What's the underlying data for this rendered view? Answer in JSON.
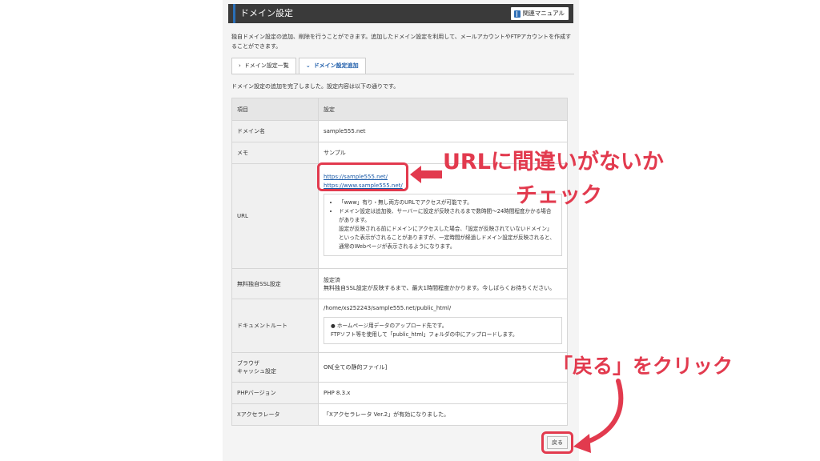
{
  "header": {
    "title": "ドメイン設定",
    "manual_label": "関連マニュアル"
  },
  "description": "独自ドメイン設定の追加、削除を行うことができます。追加したドメイン設定を利用して、メールアカウントやFTPアカウントを作成することができます。",
  "tabs": [
    {
      "label": "ドメイン設定一覧",
      "active": false
    },
    {
      "label": "ドメイン設定追加",
      "active": true
    }
  ],
  "completion_message": "ドメイン設定の追加を完了しました。設定内容は以下の通りです。",
  "table": {
    "col_item": "項目",
    "col_setting": "設定",
    "rows": {
      "domain": {
        "label": "ドメイン名",
        "value": "sample555.net"
      },
      "memo": {
        "label": "メモ",
        "value": "サンプル"
      },
      "url": {
        "label": "URL",
        "link1": "https://sample555.net/",
        "link2": "https://www.sample555.net/",
        "note1": "「www」有り・無し両方のURLでアクセスが可能です。",
        "note2": "ドメイン設定は追加後、サーバーに設定が反映されるまで数時間〜24時間程度かかる場合があります。",
        "note3": "設定が反映される前にドメインにアクセスした場合、「設定が反映されていないドメイン」といった表示がされることがありますが、一定時間が経過しドメイン設定が反映されると、通常のWebページが表示されるようになります。"
      },
      "ssl": {
        "label": "無料独自SSL設定",
        "value1": "設定済",
        "value2": "無料独自SSL設定が反映するまで、最大1時間程度かかります。今しばらくお待ちください。"
      },
      "docroot": {
        "label": "ドキュメントルート",
        "path": "/home/xs252243/sample555.net/public_html/",
        "note1": "ホームページ用データのアップロード先です。",
        "note2": "FTPソフト等を使用して「public_html」フォルダの中にアップロードします。"
      },
      "cache": {
        "label1": "ブラウザ",
        "label2": "キャッシュ設定",
        "value": "ON[全ての静的ファイル]"
      },
      "php": {
        "label": "PHPバージョン",
        "value": "PHP 8.3.x"
      },
      "xaccel": {
        "label": "Xアクセラレータ",
        "value": "「Xアクセラレータ Ver.2」が有効になりました。"
      }
    }
  },
  "back_label": "戻る",
  "annotations": {
    "url_check_line1": "URLに間違いがないか",
    "url_check_line2": "チェック",
    "back_hint": "「戻る」をクリック",
    "color": "#e23a4e"
  }
}
